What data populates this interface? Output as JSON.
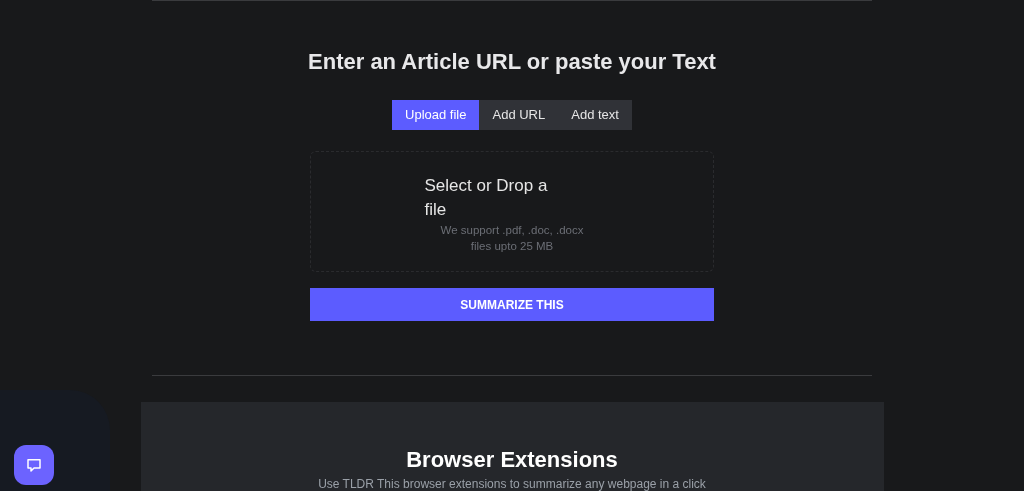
{
  "heading": "Enter an Article URL or paste your Text",
  "tabs": [
    {
      "label": "Upload file",
      "selected": true
    },
    {
      "label": "Add URL",
      "selected": false
    },
    {
      "label": "Add text",
      "selected": false
    }
  ],
  "dropzone": {
    "title": "Select or Drop a file",
    "hint": "We support .pdf, .doc, .docx files upto 25 MB"
  },
  "submit": "SUMMARIZE THIS",
  "extensions": {
    "title": "Browser Extensions",
    "text": "Use TLDR This browser extensions to summarize any webpage in a click"
  }
}
